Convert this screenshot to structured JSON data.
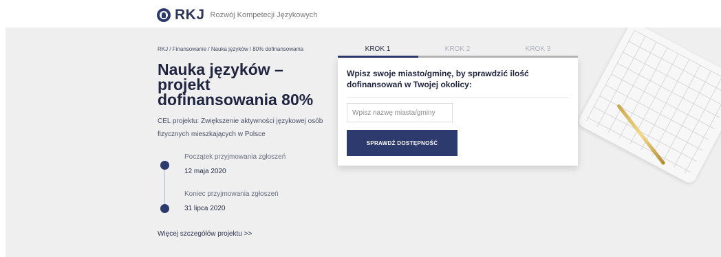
{
  "header": {
    "logo_text": "RKJ",
    "logo_subtitle": "Rozwój Kompetecji Językowych"
  },
  "hero": {
    "breadcrumb": "RKJ / Finansowanie / Nauka języków / 80% dofinansowania",
    "title": "Nauka języków – projekt dofinansowania 80%",
    "cel": "CEL projektu: Zwiększenie aktywności językowej osób fizycznych mieszkających w Polsce",
    "timeline": [
      {
        "label": "Początek przyjmowania zgłoszeń",
        "value": "12 maja 2020"
      },
      {
        "label": "Koniec przyjmowania zgłoszeń",
        "value": "31 lipca 2020"
      }
    ],
    "more_link": "Więcej szczegółów projektu >>"
  },
  "steps": [
    {
      "label": "KROK 1",
      "active": true
    },
    {
      "label": "KROK 2",
      "active": false
    },
    {
      "label": "KROK 3",
      "active": false
    }
  ],
  "form": {
    "heading": "Wpisz swoje miasto/gminę, by sprawdzić ilość dofinansowań w Twojej okolicy:",
    "city_value": "",
    "city_placeholder": "Wpisz nazwę miasta/gminy",
    "button_label": "SPRAWDŹ DOSTĘPNOŚĆ"
  },
  "colors": {
    "accent": "#2d3a6e",
    "band": "#efefef"
  },
  "icons": {
    "logo": "rkj-logo-icon",
    "timeline_dot": "timeline-dot-icon"
  }
}
